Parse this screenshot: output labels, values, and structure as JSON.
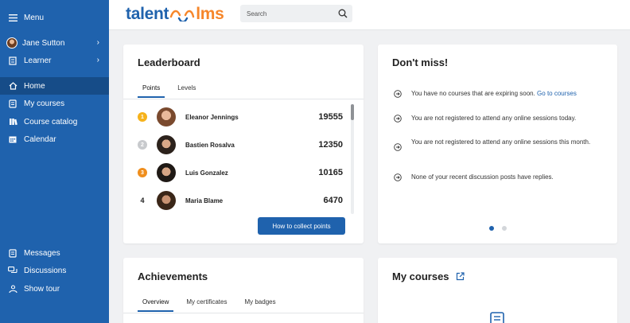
{
  "sidebar": {
    "menu_label": "Menu",
    "user_name": "Jane Sutton",
    "role_label": "Learner",
    "nav": [
      {
        "label": "Home"
      },
      {
        "label": "My courses"
      },
      {
        "label": "Course catalog"
      },
      {
        "label": "Calendar"
      }
    ],
    "bottom": [
      {
        "label": "Messages"
      },
      {
        "label": "Discussions"
      },
      {
        "label": "Show tour"
      }
    ]
  },
  "header": {
    "logo_part1": "talent",
    "logo_part2": "lms",
    "search_placeholder": "Search"
  },
  "leaderboard": {
    "title": "Leaderboard",
    "tabs": [
      "Points",
      "Levels"
    ],
    "rows": [
      {
        "rank": "1",
        "name": "Eleanor Jennings",
        "points": "19555"
      },
      {
        "rank": "2",
        "name": "Bastien Rosalva",
        "points": "12350"
      },
      {
        "rank": "3",
        "name": "Luis Gonzalez",
        "points": "10165"
      },
      {
        "rank": "4",
        "name": "Maria Blame",
        "points": "6470"
      }
    ],
    "button_label": "How to collect points"
  },
  "dont_miss": {
    "title": "Don't miss!",
    "item1_text": "You have no courses that are expiring soon.",
    "item1_link": "Go to courses",
    "item2_text": "You are not registered to attend any online sessions today.",
    "item3_text": "You are not registered to attend any online sessions this month.",
    "item4_text": "None of your recent discussion posts have replies."
  },
  "achievements": {
    "title": "Achievements",
    "tabs": [
      "Overview",
      "My certificates",
      "My badges"
    ]
  },
  "my_courses": {
    "title": "My courses"
  },
  "colors": {
    "brand_blue": "#1f62ad",
    "brand_orange": "#f6862a",
    "sidebar_active": "#164c88"
  }
}
